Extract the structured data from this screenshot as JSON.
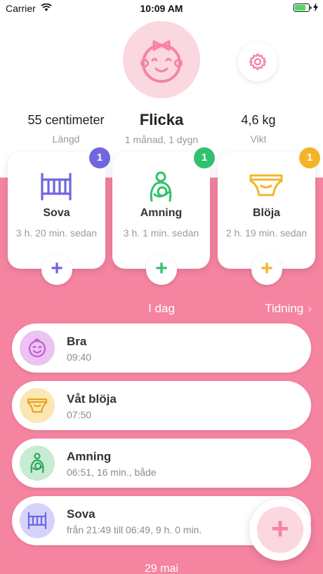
{
  "status_bar": {
    "carrier": "Carrier",
    "time": "10:09 AM"
  },
  "profile": {
    "name": "Flicka",
    "age": "1 månad, 1 dygn",
    "length_value": "55 centimeter",
    "length_label": "Längd",
    "weight_value": "4,6 kg",
    "weight_label": "Vikt"
  },
  "cards": [
    {
      "title": "Sova",
      "time": "3 h. 20 min. sedan",
      "badge": "1",
      "color": "#7066e0",
      "icon": "crib-icon"
    },
    {
      "title": "Amning",
      "time": "3 h. 1 min. sedan",
      "badge": "1",
      "color": "#2fc26b",
      "icon": "breastfeeding-icon"
    },
    {
      "title": "Blöja",
      "time": "2 h. 19 min. sedan",
      "badge": "1",
      "color": "#f4b429",
      "icon": "diaper-icon"
    }
  ],
  "add_symbol": "+",
  "section": {
    "today": "I dag",
    "timeline_link": "Tidning",
    "chevron": "›"
  },
  "events": [
    {
      "title": "Bra",
      "subtitle": "09:40",
      "icon": "happy-baby-icon"
    },
    {
      "title": "Våt blöja",
      "subtitle": "07:50",
      "icon": "diaper-icon"
    },
    {
      "title": "Amning",
      "subtitle": "06:51, 16 min., både",
      "icon": "breastfeeding-icon"
    },
    {
      "title": "Sova",
      "subtitle": "från 21:49 till 06:49, 9 h. 0 min.",
      "icon": "crib-icon"
    }
  ],
  "date_label": "29 mai",
  "colors": {
    "pink": "#f584a1",
    "light_pink": "#fbd7e0",
    "purple": "#7066e0",
    "green": "#2fc26b",
    "yellow": "#f4b429"
  }
}
